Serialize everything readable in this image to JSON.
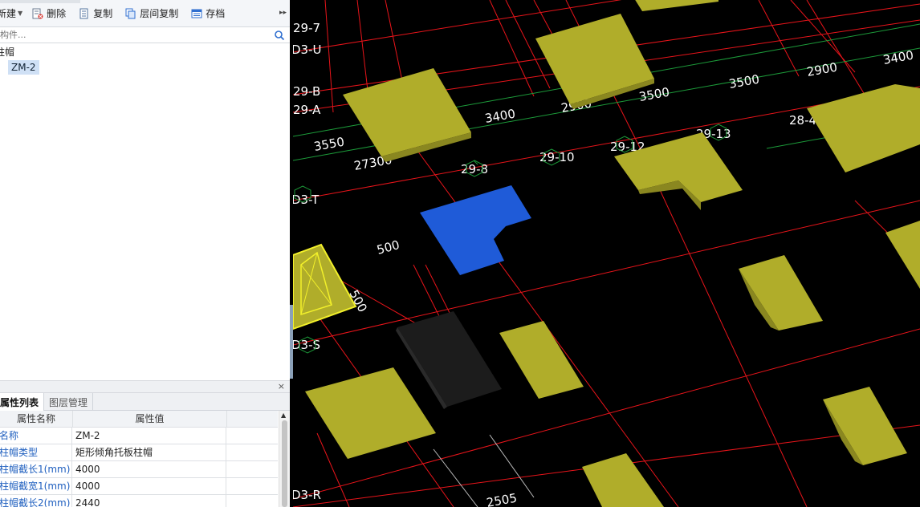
{
  "toolbar": {
    "new_label": "新建",
    "delete_label": "删除",
    "copy_label": "复制",
    "floor_copy_label": "层间复制",
    "save_label": "存档"
  },
  "search": {
    "placeholder": "搜索构件..."
  },
  "tree": {
    "category": "柱帽",
    "selected_item": "ZM-2"
  },
  "bottom_tabs": {
    "tab1": "属性列表",
    "tab2": "图层管理"
  },
  "properties": {
    "header_name": "属性名称",
    "header_value": "属性值",
    "rows": [
      {
        "name": "名称",
        "value": "ZM-2"
      },
      {
        "name": "柱帽类型",
        "value": "矩形倾角托板柱帽"
      },
      {
        "name": "柱帽截长1(mm)",
        "value": "4000"
      },
      {
        "name": "柱帽截宽1(mm)",
        "value": "4000"
      },
      {
        "name": "柱帽截长2(mm)",
        "value": "2440"
      }
    ]
  },
  "viewport": {
    "axis_labels": [
      "29-7",
      "D3-U",
      "29-B",
      "29-A",
      "D3-T",
      "D3-S",
      "D3-R",
      "29-8",
      "29-10",
      "29-12",
      "29-13",
      "28-4"
    ],
    "dimensions": [
      "3400",
      "3550",
      "27300",
      "2900",
      "3500",
      "2900",
      "3400",
      "3500",
      "500",
      "500",
      "2505"
    ],
    "colors": {
      "cap": "#b0ad2a",
      "cap_dark": "#8a8720",
      "selected": "#1f5bd8",
      "grid_red": "#e8141a",
      "grid_green": "#1c9b3a",
      "highlight": "#f2f02a"
    }
  }
}
